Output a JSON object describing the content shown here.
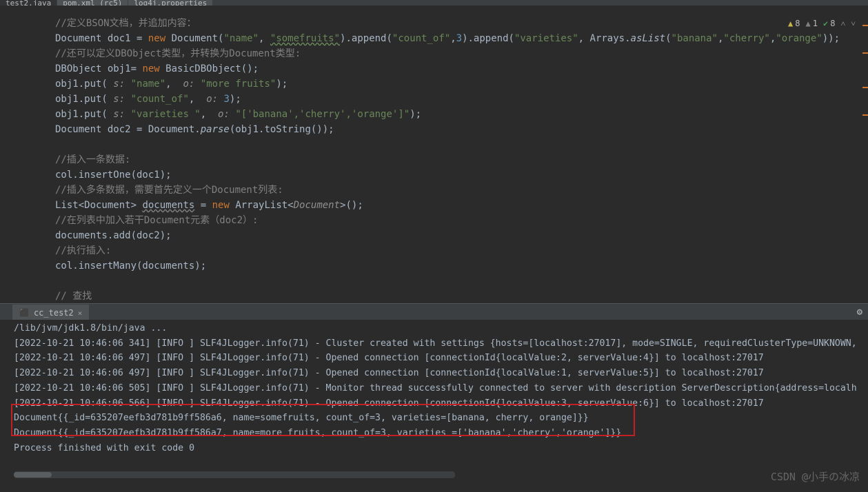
{
  "tabs": {
    "t0": "test2.java",
    "t1": "pom.xml (rc5)",
    "t2": "log4j.properties"
  },
  "indicators": {
    "err": "8",
    "warn": "1",
    "ok": "8"
  },
  "code": {
    "l0": "//定义BSON文档，并追加内容：",
    "l1_a": "Document doc1 = ",
    "l1_new": "new",
    "l1_b": " Document(",
    "l1_s1": "\"name\"",
    "l1_c": ", ",
    "l1_s2": "\"somefruits\"",
    "l1_d": ").append(",
    "l1_s3": "\"count_of\"",
    "l1_e": ",",
    "l1_n": "3",
    "l1_f": ").append(",
    "l1_s4": "\"varieties\"",
    "l1_g": ", Arrays.",
    "l1_aslist": "asList",
    "l1_h": "(",
    "l1_s5": "\"banana\"",
    "l1_i": ",",
    "l1_s6": "\"cherry\"",
    "l1_j": ",",
    "l1_s7": "\"orange\"",
    "l1_k": "));",
    "l2": "//还可以定义DBObject类型，并转换为Document类型:",
    "l3_a": "DBObject obj1= ",
    "l3_new": "new",
    "l3_b": " BasicDBObject();",
    "l4_a": "obj1.put( ",
    "l4_p1": "s: ",
    "l4_s1": "\"name\"",
    "l4_b": ",  ",
    "l4_p2": "o: ",
    "l4_s2": "\"more fruits\"",
    "l4_c": ");",
    "l5_a": "obj1.put( ",
    "l5_p1": "s: ",
    "l5_s1": "\"count_of\"",
    "l5_b": ",  ",
    "l5_p2": "o: ",
    "l5_n": "3",
    "l5_c": ");",
    "l6_a": "obj1.put( ",
    "l6_p1": "s: ",
    "l6_s1": "\"varieties \"",
    "l6_b": ",  ",
    "l6_p2": "o: ",
    "l6_s2": "\"['banana','cherry','orange']\"",
    "l6_c": ");",
    "l7_a": "Document doc2 = Document.",
    "l7_parse": "parse",
    "l7_b": "(obj1.toString());",
    "l8": "",
    "l9": "//插入一条数据:",
    "l10": "col.insertOne(doc1);",
    "l11": "//插入多条数据，需要首先定义一个Document列表:",
    "l12_a": "List<Document> ",
    "l12_var": "documents",
    "l12_b": " = ",
    "l12_new": "new",
    "l12_c": " ArrayList<",
    "l12_t": "Document",
    "l12_d": ">();",
    "l13": "//在列表中加入若干Document元素（doc2）:",
    "l14": "documents.add(doc2);",
    "l15": "//执行插入:",
    "l16": "col.insertMany(documents);",
    "l17": "",
    "l18": "// 查找"
  },
  "console": {
    "tab": "cc_test2",
    "l0": "/lib/jvm/jdk1.8/bin/java ...",
    "l1": "[2022-10-21 10:46:06 341] [INFO ] SLF4JLogger.info(71) - Cluster created with settings {hosts=[localhost:27017], mode=SINGLE, requiredClusterType=UNKNOWN,",
    "l2": "[2022-10-21 10:46:06 497] [INFO ] SLF4JLogger.info(71) - Opened connection [connectionId{localValue:2, serverValue:4}] to localhost:27017",
    "l3": "[2022-10-21 10:46:06 497] [INFO ] SLF4JLogger.info(71) - Opened connection [connectionId{localValue:1, serverValue:5}] to localhost:27017",
    "l4": "[2022-10-21 10:46:06 505] [INFO ] SLF4JLogger.info(71) - Monitor thread successfully connected to server with description ServerDescription{address=localh",
    "l5": "[2022-10-21 10:46:06 566] [INFO ] SLF4JLogger.info(71) - Opened connection [connectionId{localValue:3, serverValue:6}] to localhost:27017",
    "l6": "Document{{_id=635207eefb3d781b9ff586a6, name=somefruits, count_of=3, varieties=[banana, cherry, orange]}}",
    "l7": "Document{{_id=635207eefb3d781b9ff586a7, name=more fruits, count_of=3, varieties =['banana','cherry','orange']}}",
    "l8": "",
    "l9": "Process finished with exit code 0"
  },
  "watermark": "CSDN @小手の冰凉"
}
